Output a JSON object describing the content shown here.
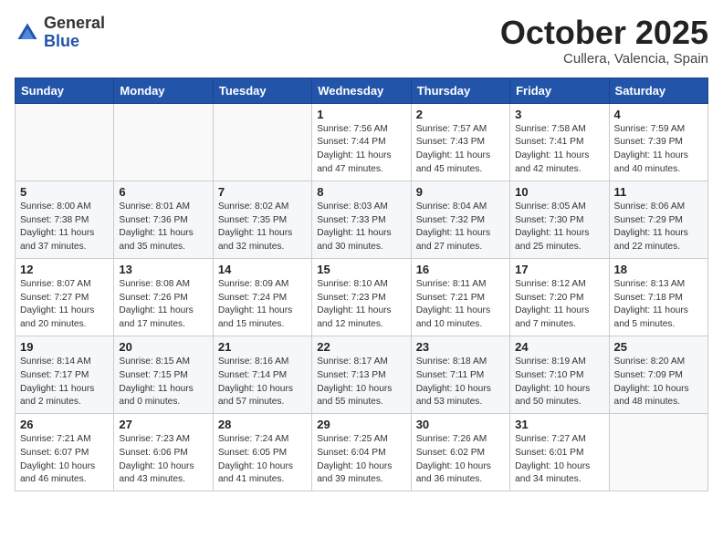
{
  "header": {
    "logo_general": "General",
    "logo_blue": "Blue",
    "month_title": "October 2025",
    "location": "Cullera, Valencia, Spain"
  },
  "weekdays": [
    "Sunday",
    "Monday",
    "Tuesday",
    "Wednesday",
    "Thursday",
    "Friday",
    "Saturday"
  ],
  "weeks": [
    [
      {
        "date": "",
        "info": ""
      },
      {
        "date": "",
        "info": ""
      },
      {
        "date": "",
        "info": ""
      },
      {
        "date": "1",
        "info": "Sunrise: 7:56 AM\nSunset: 7:44 PM\nDaylight: 11 hours\nand 47 minutes."
      },
      {
        "date": "2",
        "info": "Sunrise: 7:57 AM\nSunset: 7:43 PM\nDaylight: 11 hours\nand 45 minutes."
      },
      {
        "date": "3",
        "info": "Sunrise: 7:58 AM\nSunset: 7:41 PM\nDaylight: 11 hours\nand 42 minutes."
      },
      {
        "date": "4",
        "info": "Sunrise: 7:59 AM\nSunset: 7:39 PM\nDaylight: 11 hours\nand 40 minutes."
      }
    ],
    [
      {
        "date": "5",
        "info": "Sunrise: 8:00 AM\nSunset: 7:38 PM\nDaylight: 11 hours\nand 37 minutes."
      },
      {
        "date": "6",
        "info": "Sunrise: 8:01 AM\nSunset: 7:36 PM\nDaylight: 11 hours\nand 35 minutes."
      },
      {
        "date": "7",
        "info": "Sunrise: 8:02 AM\nSunset: 7:35 PM\nDaylight: 11 hours\nand 32 minutes."
      },
      {
        "date": "8",
        "info": "Sunrise: 8:03 AM\nSunset: 7:33 PM\nDaylight: 11 hours\nand 30 minutes."
      },
      {
        "date": "9",
        "info": "Sunrise: 8:04 AM\nSunset: 7:32 PM\nDaylight: 11 hours\nand 27 minutes."
      },
      {
        "date": "10",
        "info": "Sunrise: 8:05 AM\nSunset: 7:30 PM\nDaylight: 11 hours\nand 25 minutes."
      },
      {
        "date": "11",
        "info": "Sunrise: 8:06 AM\nSunset: 7:29 PM\nDaylight: 11 hours\nand 22 minutes."
      }
    ],
    [
      {
        "date": "12",
        "info": "Sunrise: 8:07 AM\nSunset: 7:27 PM\nDaylight: 11 hours\nand 20 minutes."
      },
      {
        "date": "13",
        "info": "Sunrise: 8:08 AM\nSunset: 7:26 PM\nDaylight: 11 hours\nand 17 minutes."
      },
      {
        "date": "14",
        "info": "Sunrise: 8:09 AM\nSunset: 7:24 PM\nDaylight: 11 hours\nand 15 minutes."
      },
      {
        "date": "15",
        "info": "Sunrise: 8:10 AM\nSunset: 7:23 PM\nDaylight: 11 hours\nand 12 minutes."
      },
      {
        "date": "16",
        "info": "Sunrise: 8:11 AM\nSunset: 7:21 PM\nDaylight: 11 hours\nand 10 minutes."
      },
      {
        "date": "17",
        "info": "Sunrise: 8:12 AM\nSunset: 7:20 PM\nDaylight: 11 hours\nand 7 minutes."
      },
      {
        "date": "18",
        "info": "Sunrise: 8:13 AM\nSunset: 7:18 PM\nDaylight: 11 hours\nand 5 minutes."
      }
    ],
    [
      {
        "date": "19",
        "info": "Sunrise: 8:14 AM\nSunset: 7:17 PM\nDaylight: 11 hours\nand 2 minutes."
      },
      {
        "date": "20",
        "info": "Sunrise: 8:15 AM\nSunset: 7:15 PM\nDaylight: 11 hours\nand 0 minutes."
      },
      {
        "date": "21",
        "info": "Sunrise: 8:16 AM\nSunset: 7:14 PM\nDaylight: 10 hours\nand 57 minutes."
      },
      {
        "date": "22",
        "info": "Sunrise: 8:17 AM\nSunset: 7:13 PM\nDaylight: 10 hours\nand 55 minutes."
      },
      {
        "date": "23",
        "info": "Sunrise: 8:18 AM\nSunset: 7:11 PM\nDaylight: 10 hours\nand 53 minutes."
      },
      {
        "date": "24",
        "info": "Sunrise: 8:19 AM\nSunset: 7:10 PM\nDaylight: 10 hours\nand 50 minutes."
      },
      {
        "date": "25",
        "info": "Sunrise: 8:20 AM\nSunset: 7:09 PM\nDaylight: 10 hours\nand 48 minutes."
      }
    ],
    [
      {
        "date": "26",
        "info": "Sunrise: 7:21 AM\nSunset: 6:07 PM\nDaylight: 10 hours\nand 46 minutes."
      },
      {
        "date": "27",
        "info": "Sunrise: 7:23 AM\nSunset: 6:06 PM\nDaylight: 10 hours\nand 43 minutes."
      },
      {
        "date": "28",
        "info": "Sunrise: 7:24 AM\nSunset: 6:05 PM\nDaylight: 10 hours\nand 41 minutes."
      },
      {
        "date": "29",
        "info": "Sunrise: 7:25 AM\nSunset: 6:04 PM\nDaylight: 10 hours\nand 39 minutes."
      },
      {
        "date": "30",
        "info": "Sunrise: 7:26 AM\nSunset: 6:02 PM\nDaylight: 10 hours\nand 36 minutes."
      },
      {
        "date": "31",
        "info": "Sunrise: 7:27 AM\nSunset: 6:01 PM\nDaylight: 10 hours\nand 34 minutes."
      },
      {
        "date": "",
        "info": ""
      }
    ]
  ]
}
